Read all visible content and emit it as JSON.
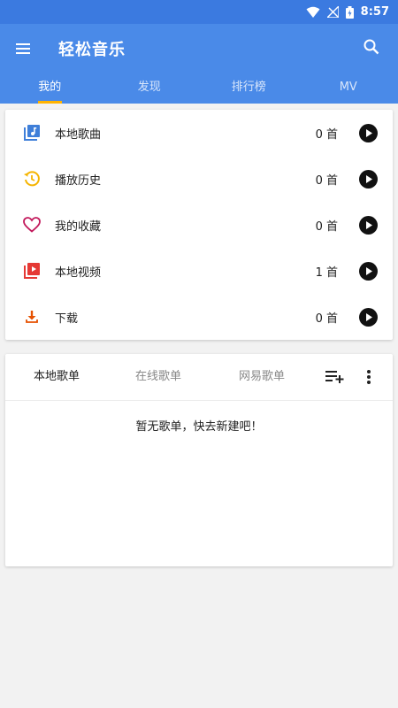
{
  "status_bar": {
    "time": "8:57",
    "icons": [
      "wifi-icon",
      "no-signal-icon",
      "battery-icon"
    ]
  },
  "app_bar": {
    "title": "轻松音乐",
    "menu_icon": "menu-icon",
    "search_icon": "search-icon"
  },
  "tabs": [
    {
      "label": "我的",
      "active": true
    },
    {
      "label": "发现",
      "active": false
    },
    {
      "label": "排行榜",
      "active": false
    },
    {
      "label": "MV",
      "active": false
    }
  ],
  "library": [
    {
      "label": "本地歌曲",
      "count": "0 首",
      "icon": "music-file-icon",
      "icon_color": "#3f7fd9"
    },
    {
      "label": "播放历史",
      "count": "0 首",
      "icon": "history-icon",
      "icon_color": "#f5b400"
    },
    {
      "label": "我的收藏",
      "count": "0 首",
      "icon": "heart-icon",
      "icon_color": "#c2185b"
    },
    {
      "label": "本地视频",
      "count": "1 首",
      "icon": "video-icon",
      "icon_color": "#e53935"
    },
    {
      "label": "下载",
      "count": "0 首",
      "icon": "download-icon",
      "icon_color": "#e65100"
    }
  ],
  "playlists": {
    "tabs": [
      {
        "label": "本地歌单",
        "active": true
      },
      {
        "label": "在线歌单",
        "active": false
      },
      {
        "label": "网易歌单",
        "active": false
      }
    ],
    "empty_message": "暂无歌单，快去新建吧！"
  },
  "colors": {
    "primary": "#4a8ae8",
    "status_bar": "#3b7ae0",
    "tab_indicator": "#ffb300"
  }
}
